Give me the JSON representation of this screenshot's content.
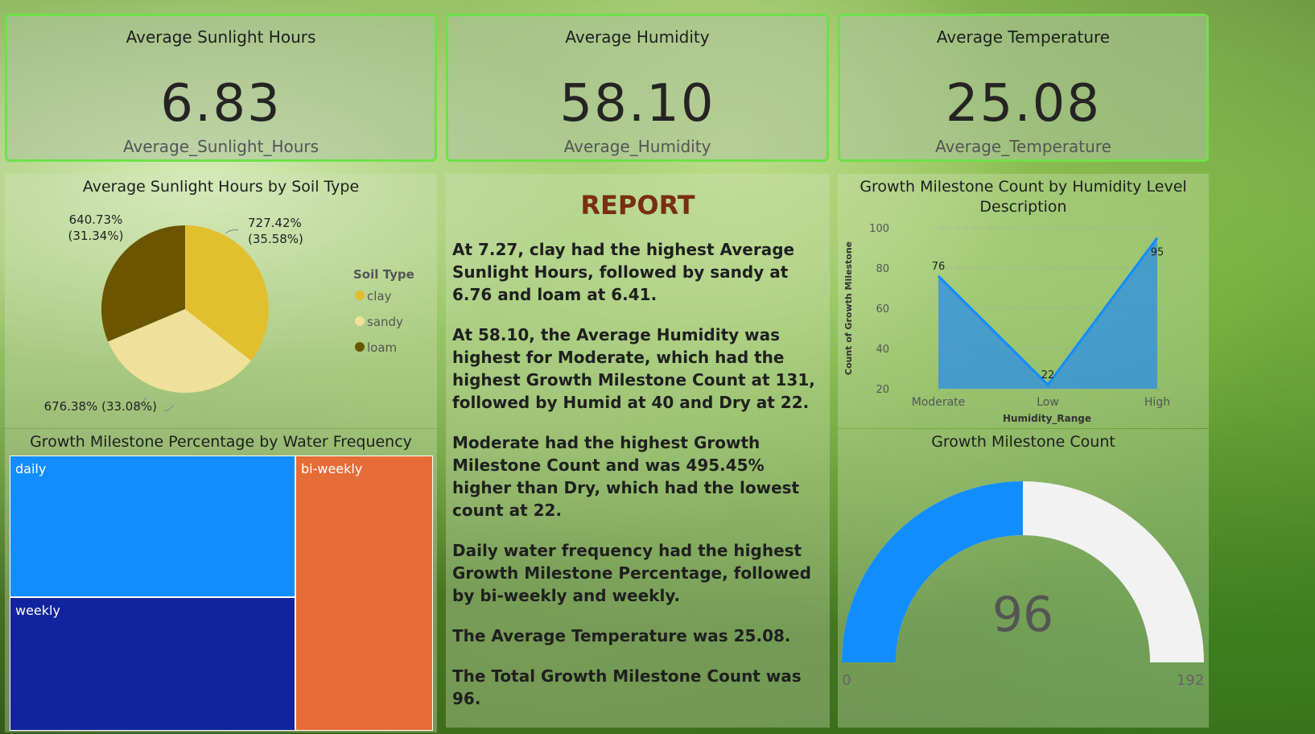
{
  "cards": [
    {
      "title": "Average Sunlight Hours",
      "value": "6.83",
      "label": "Average_Sunlight_Hours"
    },
    {
      "title": "Average Humidity",
      "value": "58.10",
      "label": "Average_Humidity"
    },
    {
      "title": "Average Temperature",
      "value": "25.08",
      "label": "Average_Temperature"
    }
  ],
  "pie": {
    "title": "Average Sunlight Hours by Soil Type",
    "legend_title": "Soil Type",
    "slices": [
      {
        "name": "clay",
        "label": "727.42%",
        "pct": "(35.58%)",
        "color": "#e2bf2e"
      },
      {
        "name": "sandy",
        "label": "676.38% (33.08%)",
        "color": "#f0e19a"
      },
      {
        "name": "loam",
        "label": "640.73%",
        "pct": "(31.34%)",
        "color": "#6b5500"
      }
    ]
  },
  "report": {
    "title": "REPORT",
    "paragraphs": [
      "At 7.27, clay had the highest Average Sunlight Hours, followed by sandy at 6.76 and loam at 6.41.",
      "At 58.10, the Average Humidity was highest for Moderate, which had the highest Growth Milestone Count at 131, followed by Humid at 40 and Dry at 22.",
      "Moderate had the highest Growth Milestone Count and was 495.45% higher than Dry, which had the lowest count at 22.",
      "Daily water frequency had the highest Growth Milestone Percentage, followed by bi-weekly and weekly.",
      "The Average Temperature was 25.08.",
      "The Total Growth Milestone Count was 96."
    ]
  },
  "treemap": {
    "title": "Growth Milestone Percentage by Water Frequency",
    "cells": [
      {
        "name": "daily",
        "color": "#118dff"
      },
      {
        "name": "bi-weekly",
        "color": "#e66c37"
      },
      {
        "name": "weekly",
        "color": "#12239e"
      }
    ]
  },
  "gauge": {
    "title": "Growth Milestone Count",
    "value_text": "96",
    "min_text": "0",
    "max_text": "192",
    "fill_color": "#118dff",
    "track_color": "#f2f2f2"
  },
  "chart_data": [
    {
      "type": "pie",
      "title": "Average Sunlight Hours by Soil Type",
      "categories": [
        "clay",
        "sandy",
        "loam"
      ],
      "values": [
        727.42,
        676.38,
        640.73
      ],
      "percentages": [
        35.58,
        33.08,
        31.34
      ],
      "legend": "right"
    },
    {
      "type": "area",
      "title": "Growth Milestone Count by Humidity Level Description",
      "xlabel": "Humidity_Range",
      "ylabel": "Count of Growth Milestone",
      "categories": [
        "Moderate",
        "Low",
        "High"
      ],
      "values": [
        76,
        22,
        95
      ],
      "ylim": [
        20,
        100
      ],
      "yticks": [
        "100",
        "80",
        "60",
        "40",
        "20"
      ],
      "grid": true,
      "color": "#118dff"
    },
    {
      "type": "treemap",
      "title": "Growth Milestone Percentage by Water Frequency",
      "categories": [
        "daily",
        "bi-weekly",
        "weekly"
      ]
    },
    {
      "type": "gauge",
      "title": "Growth Milestone Count",
      "value": 96,
      "min": 0,
      "max": 192
    }
  ]
}
